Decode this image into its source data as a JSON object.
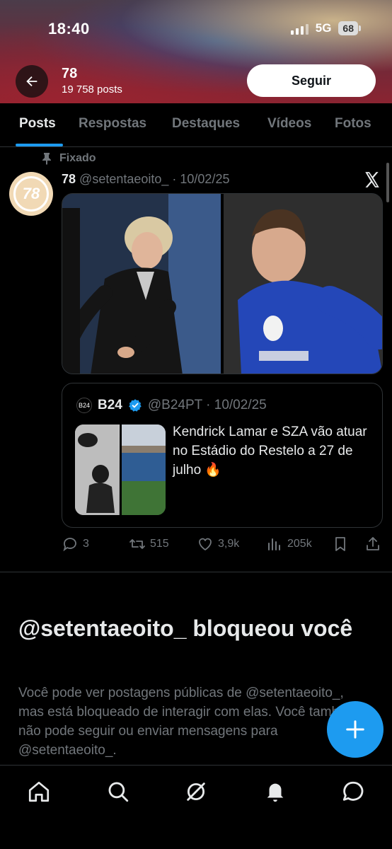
{
  "status_bar": {
    "time": "18:40",
    "network": "5G",
    "battery": "68"
  },
  "profile": {
    "name": "78",
    "posts_count": "19 758 posts",
    "follow_label": "Seguir"
  },
  "tabs": [
    {
      "label": "Posts",
      "active": true
    },
    {
      "label": "Respostas",
      "active": false
    },
    {
      "label": "Destaques",
      "active": false
    },
    {
      "label": "Vídeos",
      "active": false
    },
    {
      "label": "Fotos",
      "active": false
    }
  ],
  "tweet": {
    "pinned_label": "Fixado",
    "avatar_text": "78",
    "author": "78",
    "handle_date": "@setentaeoito_ · 10/02/25",
    "quote": {
      "logo_text": "B24",
      "author": "B24",
      "handle_date": "@B24PT · 10/02/25",
      "text": "Kendrick Lamar e SZA vão atuar no Estádio do Restelo a 27 de julho 🔥"
    },
    "stats": {
      "replies": "3",
      "reposts": "515",
      "likes": "3,9k",
      "views": "205k"
    }
  },
  "blocked": {
    "title": "@setentaeoito_ bloqueou você",
    "description": "Você pode ver postagens públicas de @setentaeoito_, mas está bloqueado de interagir com elas. Você também não pode seguir ou enviar mensagens para @setentaeoito_."
  },
  "colors": {
    "accent": "#1d9bf0",
    "muted": "#71767b",
    "text": "#e7e9ea",
    "background": "#000000"
  },
  "icons": [
    "back-arrow-icon",
    "pin-icon",
    "x-logo-icon",
    "verified-icon",
    "reply-icon",
    "repost-icon",
    "like-icon",
    "views-icon",
    "bookmark-icon",
    "share-icon",
    "compose-icon",
    "home-icon",
    "search-icon",
    "grok-icon",
    "notifications-icon",
    "messages-icon"
  ]
}
